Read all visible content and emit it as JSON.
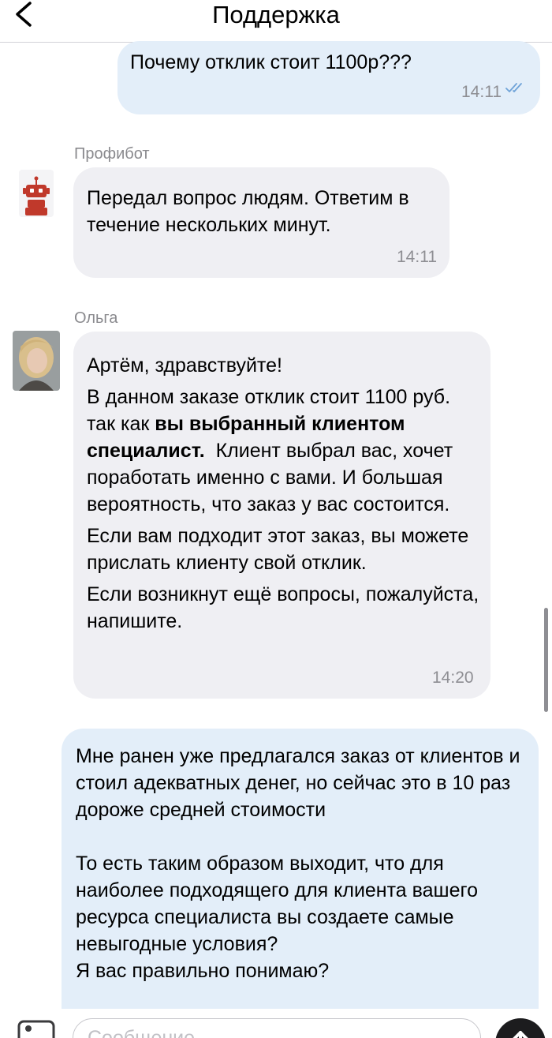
{
  "header": {
    "title": "Поддержка",
    "back_icon": "chevron-left-icon"
  },
  "messages": [
    {
      "direction": "outgoing",
      "text": "Почему отклик стоит 1100р???",
      "time": "14:11",
      "status_icon": "double-check-icon"
    },
    {
      "direction": "incoming",
      "sender": "Профибот",
      "avatar_icon": "robot-icon",
      "text": "Передал вопрос людям. Ответим в течение нескольких минут.",
      "time": "14:11"
    },
    {
      "direction": "incoming",
      "sender": "Ольга",
      "avatar_icon": "user-photo",
      "paragraphs": {
        "p1": "Артём, здравствуйте!",
        "p2_before": "В данном заказе отклик стоит 1100 руб. так как ",
        "p2_bold": "вы  выбранный клиентом специалист.",
        "p2_after": "  Клиент выбрал вас, хочет поработать именно с вами. И большая вероятность, что заказ у вас состоится.",
        "p3": "Если вам подходит этот заказ, вы можете прислать клиенту свой отклик.",
        "p4": "Если возникнут ещё вопросы, пожалуйста, напишите."
      },
      "time": "14:20"
    },
    {
      "direction": "outgoing",
      "paragraphs": {
        "p1": "Мне ранен уже предлагался заказ от клиентов и стоил адекватных денег, но сейчас это в 10 раз дороже средней стоимости",
        "p2": "То есть таким образом выходит, что для наиболее подходящего для клиента вашего ресурса специалиста вы создаете самые невыгодные условия?",
        "p3": "Я вас правильно понимаю?"
      }
    }
  ],
  "composer": {
    "placeholder": "Сообщение",
    "photo_icon": "image-icon",
    "send_icon": "arrow-up-icon"
  },
  "colors": {
    "outgoing_bubble": "#e3eef9",
    "incoming_bubble": "#efeff3",
    "robot_red": "#c0392b",
    "check_blue": "#6fa3d8"
  }
}
